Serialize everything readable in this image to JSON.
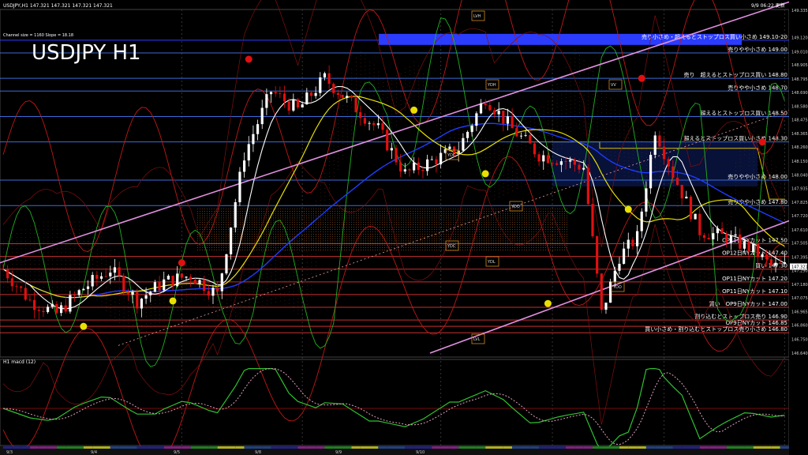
{
  "window": {
    "symbol_header": "USDJPY,H1  147.321 147.321 147.321 147.321",
    "timestamp": "9/9 06:22 更新",
    "big_title": "USDJPY H1",
    "channel_info": "Channel size = 1160 Slope = 18.18",
    "macd_label": "H1  macd (12)"
  },
  "price_axis": [
    {
      "v": 149.335,
      "t": "149.335"
    },
    {
      "v": 149.12,
      "t": "149.120"
    },
    {
      "v": 149.01,
      "t": "149.010"
    },
    {
      "v": 148.905,
      "t": "148.905"
    },
    {
      "v": 148.795,
      "t": "148.795"
    },
    {
      "v": 148.69,
      "t": "148.690"
    },
    {
      "v": 148.58,
      "t": "148.580"
    },
    {
      "v": 148.475,
      "t": "148.475"
    },
    {
      "v": 148.365,
      "t": "148.365"
    },
    {
      "v": 148.26,
      "t": "148.260"
    },
    {
      "v": 148.15,
      "t": "148.150"
    },
    {
      "v": 148.04,
      "t": "148.040"
    },
    {
      "v": 147.935,
      "t": "147.935"
    },
    {
      "v": 147.825,
      "t": "147.825"
    },
    {
      "v": 147.72,
      "t": "147.720"
    },
    {
      "v": 147.61,
      "t": "147.610"
    },
    {
      "v": 147.505,
      "t": "147.505"
    },
    {
      "v": 147.395,
      "t": "147.395"
    },
    {
      "v": 147.32,
      "t": "147.321"
    },
    {
      "v": 147.29,
      "t": "147.290"
    },
    {
      "v": 147.18,
      "t": "147.180"
    },
    {
      "v": 147.075,
      "t": "147.075"
    },
    {
      "v": 146.965,
      "t": "146.965"
    },
    {
      "v": 146.86,
      "t": "146.860"
    },
    {
      "v": 146.75,
      "t": "146.750"
    },
    {
      "v": 146.64,
      "t": "146.640"
    }
  ],
  "macd_axis": [
    {
      "v": 0.442,
      "t": "0.442"
    },
    {
      "v": 0.0,
      "t": "0.00"
    },
    {
      "v": -0.472,
      "t": "-0.472"
    }
  ],
  "date_axis": [
    "9/3",
    "9/4",
    "9/5",
    "9/8",
    "9/9",
    "9/10"
  ],
  "levels": [
    {
      "price": 149.1,
      "label": "売り小さめ・超えるとストップロス買い小さめ 149.10-20",
      "color": "#2b3cff",
      "band": true
    },
    {
      "price": 149.0,
      "label": "売りやや小さめ 149.00",
      "color": "#3a6bd8"
    },
    {
      "price": 148.8,
      "label": "売り　超えるとストップロス買い 148.80",
      "color": "#3a6bd8"
    },
    {
      "price": 148.7,
      "label": "売りやや小さめ 148.70",
      "color": "#3a6bd8"
    },
    {
      "price": 148.5,
      "label": "超えるとストップロス買い 148.50",
      "color": "#3a6bd8"
    },
    {
      "price": 148.3,
      "label": "超えるとストップロス買い小さめ 148.30",
      "color": "#3a6bd8"
    },
    {
      "price": 148.0,
      "label": "売りやや小さめ 148.00",
      "color": "#3a6bd8"
    },
    {
      "price": 147.8,
      "label": "売りやや小さめ 147.80",
      "color": "#3a6bd8"
    },
    {
      "price": 147.5,
      "label": "OP11日NYカット 147.50",
      "color": "#c83030"
    },
    {
      "price": 147.4,
      "label": "OP12日NYカット 147.40",
      "color": "#c83030"
    },
    {
      "price": 147.3,
      "label": "買い 147.30",
      "color": "#c83030"
    },
    {
      "price": 147.2,
      "label": "OP11日NYカット 147.20",
      "color": "#c83030"
    },
    {
      "price": 147.1,
      "label": "OP11日NYカット 147.10",
      "color": "#c83030"
    },
    {
      "price": 147.0,
      "label": "買い　OP9日NYカット 147.00",
      "color": "#c83030"
    },
    {
      "price": 146.9,
      "label": "割り込むとストップロス売り 146.90",
      "color": "#c83030"
    },
    {
      "price": 146.85,
      "label": "OP9日NYカット 146.85",
      "color": "#c83030"
    },
    {
      "price": 146.8,
      "label": "買い小さめ・割り込むとストップロス売り小さめ 146.80",
      "color": "#c83030"
    }
  ],
  "box_labels": [
    "LVH",
    "YDH",
    "VV",
    "YDC",
    "YDC",
    "YDL",
    "LVL",
    "YDO",
    "YDO"
  ],
  "chart_data": {
    "type": "candlestick",
    "symbol": "USDJPY",
    "timeframe": "H1",
    "ylim": [
      146.6,
      149.4
    ],
    "series": [
      {
        "name": "price",
        "approx_path": [
          [
            0,
            147.3
          ],
          [
            6,
            147.05
          ],
          [
            12,
            146.95
          ],
          [
            18,
            147.15
          ],
          [
            24,
            147.3
          ],
          [
            30,
            147.05
          ],
          [
            36,
            147.2
          ],
          [
            42,
            147.25
          ],
          [
            48,
            147.1
          ],
          [
            54,
            148.2
          ],
          [
            60,
            148.7
          ],
          [
            66,
            148.55
          ],
          [
            72,
            148.8
          ],
          [
            78,
            148.6
          ],
          [
            84,
            148.4
          ],
          [
            90,
            148.05
          ],
          [
            96,
            148.15
          ],
          [
            102,
            148.25
          ],
          [
            108,
            148.65
          ],
          [
            114,
            148.4
          ],
          [
            120,
            148.2
          ],
          [
            126,
            148.15
          ],
          [
            130,
            148.1
          ],
          [
            134,
            146.95
          ],
          [
            138,
            147.4
          ],
          [
            142,
            147.55
          ],
          [
            146,
            148.4
          ],
          [
            150,
            148.05
          ],
          [
            156,
            147.6
          ],
          [
            162,
            147.55
          ],
          [
            168,
            147.45
          ],
          [
            172,
            147.32
          ]
        ]
      }
    ]
  },
  "colors": {
    "bull": "#ffffff",
    "bear": "#e01010",
    "yellow": "#e8e000",
    "blue": "#1e3cff",
    "pink": "#e090e0",
    "green": "#20b020",
    "red": "#c01818"
  }
}
